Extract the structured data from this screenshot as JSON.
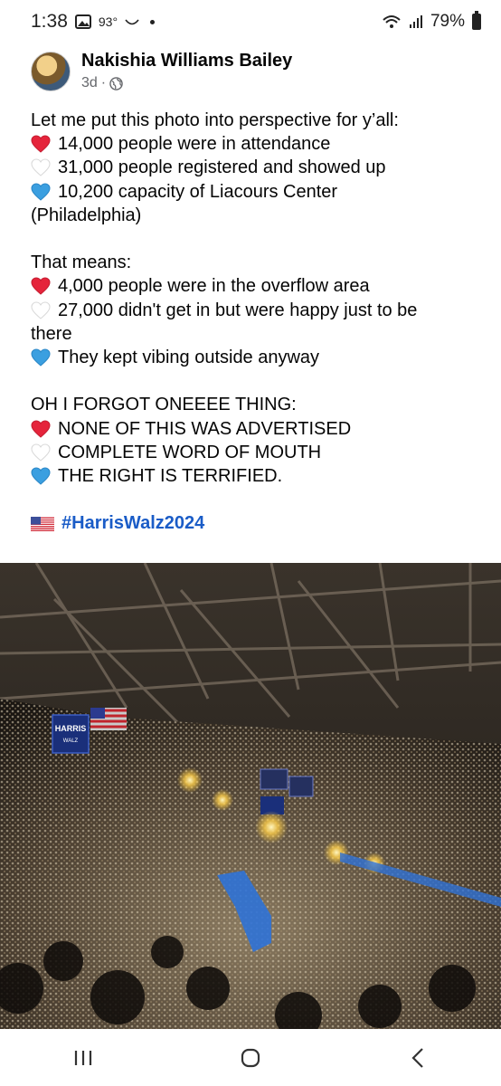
{
  "status_bar": {
    "time": "1:38",
    "temperature": "93°",
    "battery": "79%"
  },
  "post": {
    "author": "Nakishia Williams Bailey",
    "age": "3d",
    "separator": "·",
    "lines": [
      {
        "icon": "",
        "text": "Let me put this photo into perspective for y’all:"
      },
      {
        "icon": "red-heart",
        "text": "14,000 people were in attendance"
      },
      {
        "icon": "white-heart",
        "text": "31,000 people registered and showed up"
      },
      {
        "icon": "blue-heart",
        "text": "10,200 capacity of Liacours Center"
      },
      {
        "icon": "",
        "text": "(Philadelphia)"
      },
      {
        "icon": "",
        "text": ""
      },
      {
        "icon": "",
        "text": "That means:"
      },
      {
        "icon": "red-heart",
        "text": "4,000 people were in the overflow area"
      },
      {
        "icon": "white-heart",
        "text": "27,000 didn't get in but were happy just to be"
      },
      {
        "icon": "",
        "text": "there"
      },
      {
        "icon": "blue-heart",
        "text": "They kept vibing outside anyway"
      },
      {
        "icon": "",
        "text": ""
      },
      {
        "icon": "",
        "text": "OH I FORGOT ONEEEE THING:"
      },
      {
        "icon": "red-heart",
        "text": "NONE OF THIS WAS ADVERTISED"
      },
      {
        "icon": "white-heart",
        "text": "COMPLETE WORD OF MOUTH"
      },
      {
        "icon": "blue-heart",
        "text": "THE RIGHT IS TERRIFIED."
      },
      {
        "icon": "",
        "text": ""
      }
    ],
    "hashtag": "#HarrisWalz2024",
    "hashtag_icon": "us-flag-icon"
  },
  "photo": {
    "banner_text_1": "HARRIS",
    "banner_text_2": "WALZ"
  },
  "colors": {
    "hashtag": "#1a5cc7",
    "red_heart": "#e5243b",
    "blue_heart": "#3b9fe0"
  }
}
